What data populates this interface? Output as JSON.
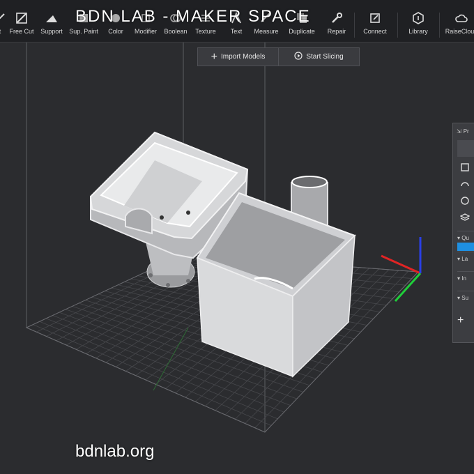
{
  "toolbar": {
    "items": [
      {
        "label": "t",
        "icon": "cut-icon"
      },
      {
        "label": "Free Cut",
        "icon": "free-cut-icon"
      },
      {
        "label": "Support",
        "icon": "support-icon"
      },
      {
        "label": "Sup. Paint",
        "icon": "support-paint-icon"
      },
      {
        "label": "Color",
        "icon": "color-icon"
      },
      {
        "label": "Modifier",
        "icon": "modifier-icon"
      },
      {
        "label": "Boolean",
        "icon": "boolean-icon"
      },
      {
        "label": "Texture",
        "icon": "texture-icon"
      },
      {
        "label": "Text",
        "icon": "text-icon"
      },
      {
        "label": "Measure",
        "icon": "measure-icon"
      },
      {
        "label": "Duplicate",
        "icon": "duplicate-icon"
      },
      {
        "label": "Repair",
        "icon": "wrench-icon"
      },
      {
        "label": "Connect",
        "icon": "connect-icon"
      },
      {
        "label": "Library",
        "icon": "library-icon"
      },
      {
        "label": "RaiseCloud",
        "icon": "cloud-icon"
      }
    ]
  },
  "overlay": {
    "title": "BDN LAB - MAKER SPACE",
    "footer": "bdnlab.org"
  },
  "actions": {
    "import_label": "Import Models",
    "slice_label": "Start Slicing"
  },
  "side_panel": {
    "header": "Pr",
    "rows": [
      "Qu",
      "La",
      "In",
      "Su"
    ],
    "accent_color": "#1e8fe1"
  },
  "axes": {
    "x_color": "#e02424",
    "y_color": "#1fcf3a",
    "z_color": "#2a3fe6"
  }
}
